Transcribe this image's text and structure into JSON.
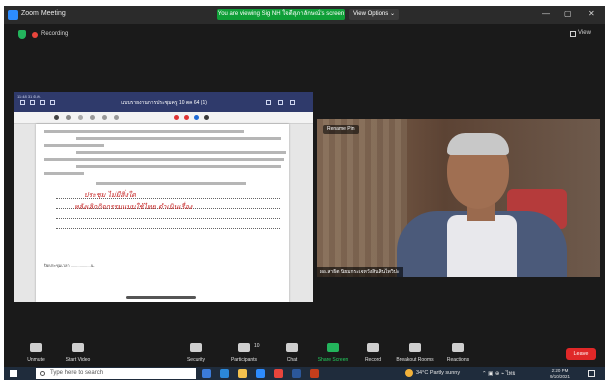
{
  "window": {
    "title": "Zoom Meeting",
    "share_banner": "You are viewing Sig NH ใจดีสุภาลักษณ์'s screen",
    "view_options": "View Options ⌄",
    "controls": [
      "—",
      "▢",
      "✕"
    ]
  },
  "status": {
    "recording_label": "Recording",
    "view_label": "View"
  },
  "shared_screen": {
    "status_bar": "11:48 31 ต.ค.",
    "doc_title": "แบบรายงานการประชุมครู 10 ตค 64 (1)",
    "pen_colors": [
      "#e03434",
      "#e03434",
      "#1e6ad6",
      "#3a3a3a"
    ],
    "handwriting": [
      "ประชุม ไม่มีสิ่งใด",
      "หลังเลิกกิจกรรมแบบใช้ไทย ดำเนินเรื่อง"
    ],
    "footer": "ปิดประชุมเวลา ..................น."
  },
  "video": {
    "rename_label": "Rename Pin",
    "participant_name": "ผอ.สาธิต นิยมกระเจหวังสินสินไพวิปะ"
  },
  "controls": {
    "unmute": "Unmute",
    "start_video": "Start Video",
    "security": "Security",
    "participants": "Participants",
    "participants_count": "10",
    "chat": "Chat",
    "share_screen": "Share Screen",
    "record": "Record",
    "breakout_rooms": "Breakout Rooms",
    "reactions": "Reactions",
    "leave": "Leave"
  },
  "taskbar": {
    "search_placeholder": "Type here to search",
    "weather": "34°C  Partly sunny",
    "tray": "⌃ ▣ ⊕ ⌁ ไทย",
    "time": "2:20 PM",
    "date": "9/10/2021"
  }
}
